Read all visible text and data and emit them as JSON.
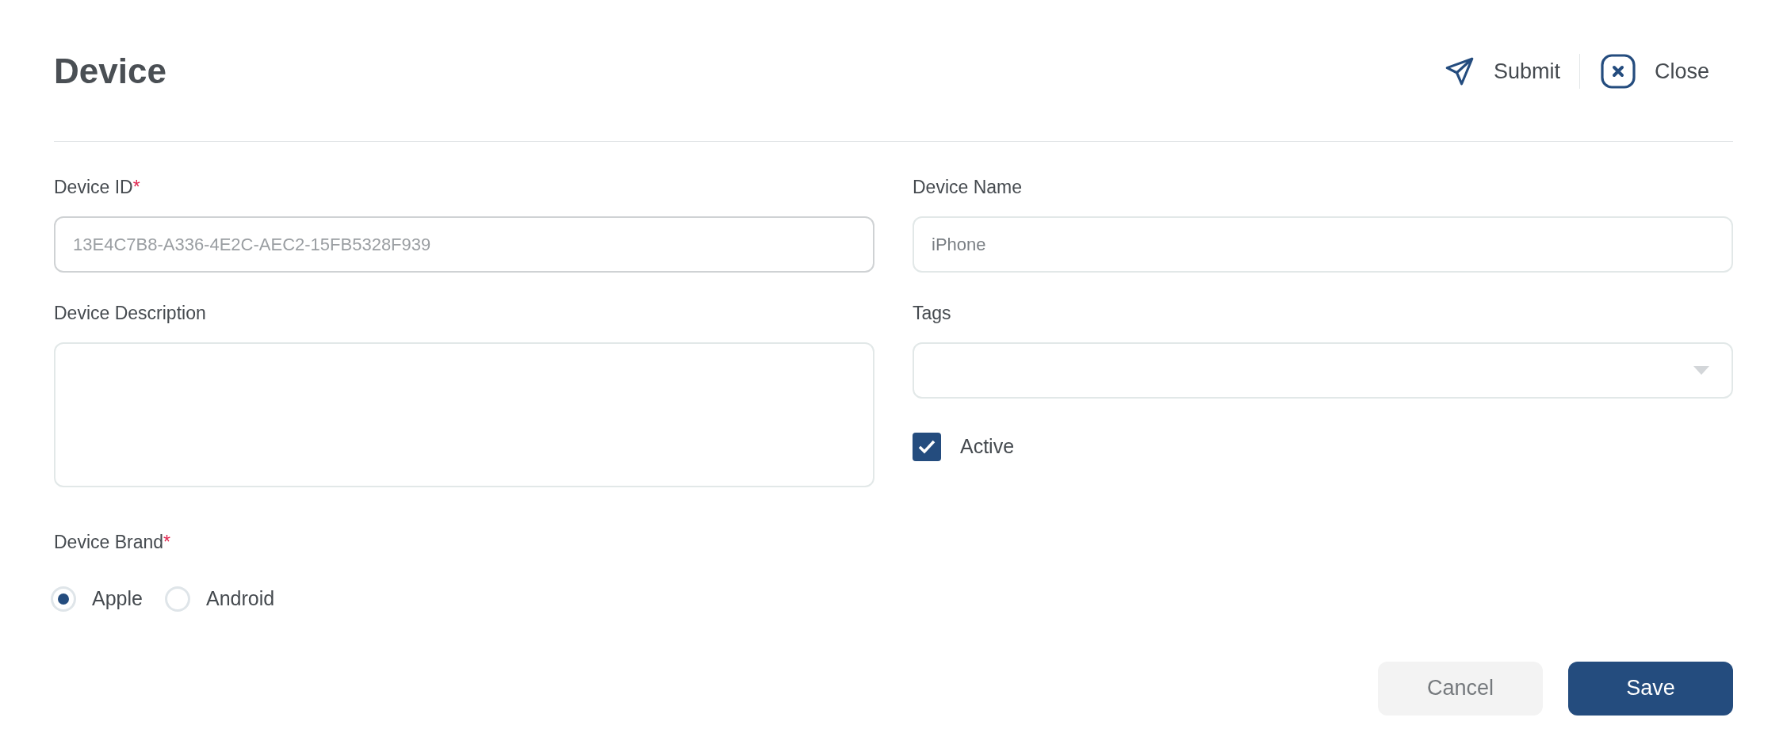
{
  "header": {
    "title": "Device",
    "actions": [
      {
        "kind": "submit",
        "label": "Submit"
      },
      {
        "kind": "close",
        "label": "Close"
      }
    ]
  },
  "fields": {
    "device_id": {
      "label": "Device ID",
      "required_mark": "*",
      "value": "13E4C7B8-A336-4E2C-AEC2-15FB5328F939"
    },
    "device_name": {
      "label": "Device Name",
      "value": "iPhone"
    },
    "device_description": {
      "label": "Device Description"
    },
    "tags": {
      "label": "Tags"
    },
    "active": {
      "label": "Active",
      "checked": true
    },
    "device_brand": {
      "label": "Device Brand",
      "required_mark": "*",
      "options": [
        {
          "label": "Apple",
          "selected": true
        },
        {
          "label": "Android",
          "selected": false
        }
      ]
    }
  },
  "footer": {
    "buttons": [
      {
        "kind": "secondary",
        "label": "Cancel"
      },
      {
        "kind": "primary",
        "label": "Save"
      }
    ]
  }
}
